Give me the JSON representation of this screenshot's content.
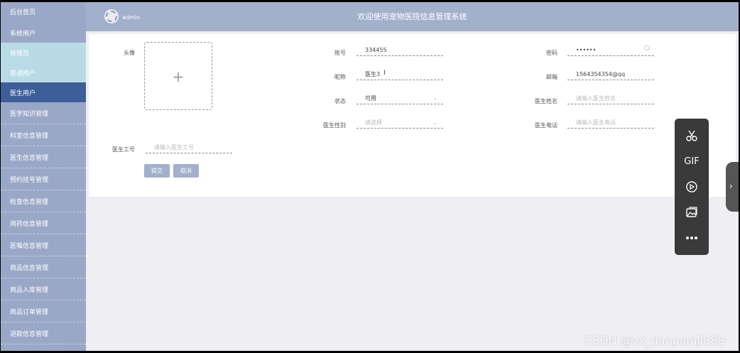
{
  "header": {
    "title": "欢迎使用宠物医院信息管理系统",
    "user": "admin"
  },
  "sidebar": {
    "items": [
      {
        "label": "后台首页"
      },
      {
        "label": "系统用户"
      },
      {
        "label": "管理员"
      },
      {
        "label": "普通用户"
      },
      {
        "label": "医生用户"
      },
      {
        "label": "医学知识管理"
      },
      {
        "label": "科室信息管理"
      },
      {
        "label": "医生信息管理"
      },
      {
        "label": "预约挂号管理"
      },
      {
        "label": "检查信息管理"
      },
      {
        "label": "用药信息管理"
      },
      {
        "label": "医嘱信息管理"
      },
      {
        "label": "商品信息管理"
      },
      {
        "label": "商品入库管理"
      },
      {
        "label": "商品订单管理"
      },
      {
        "label": "退款信息管理"
      }
    ]
  },
  "form": {
    "avatar_label": "头像",
    "account": {
      "label": "账号",
      "value": "334455"
    },
    "password": {
      "label": "密码",
      "value": "••••••"
    },
    "nickname": {
      "label": "昵称",
      "value": "医生3"
    },
    "email": {
      "label": "邮箱",
      "value": "1564354354@qq"
    },
    "status": {
      "label": "状态",
      "value": "可用"
    },
    "doctor_name": {
      "label": "医生姓名",
      "placeholder": "请输入医生姓名"
    },
    "doctor_gender": {
      "label": "医生性别",
      "placeholder": "请选择"
    },
    "doctor_phone": {
      "label": "医生电话",
      "placeholder": "请输入医生电话"
    },
    "doctor_id": {
      "label": "医生工号",
      "placeholder": "请输入医生工号"
    },
    "submit_label": "提交",
    "cancel_label": "取消"
  },
  "toolbar": {
    "items": [
      {
        "icon": "scissors-icon"
      },
      {
        "label": "GIF"
      },
      {
        "icon": "play-circle-icon"
      },
      {
        "icon": "image-icon"
      },
      {
        "icon": "more-icon"
      }
    ]
  },
  "watermark": "CSDN @vx_danpianji889"
}
